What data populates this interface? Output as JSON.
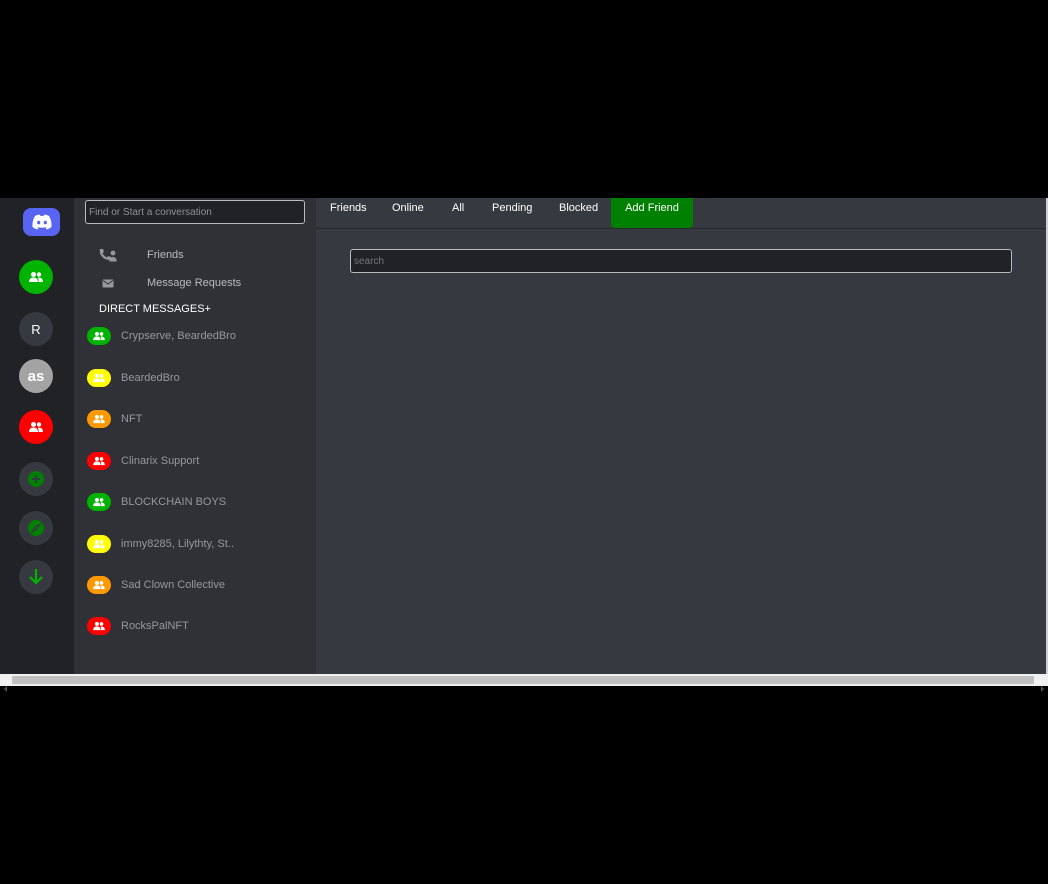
{
  "colors": {
    "discord": "#5865f2",
    "green": "#00b300",
    "yellow": "#ffff00",
    "orange": "#ff9900",
    "red": "#ff0000",
    "add_friend_bg": "#008000",
    "server_bg": "#36393f"
  },
  "servers": {
    "home_icon": "discord-logo-icon",
    "items": [
      {
        "icon": "group-icon",
        "color": "#00b300"
      },
      {
        "letter": "R"
      },
      {
        "letter": "as"
      },
      {
        "icon": "group-icon",
        "color": "#ff0000"
      },
      {
        "icon": "plus-icon"
      },
      {
        "icon": "compass-icon"
      },
      {
        "icon": "download-icon"
      }
    ]
  },
  "search": {
    "placeholder": "Find or Start a conversation"
  },
  "nav": {
    "friends": {
      "label": "Friends",
      "icon": "friends-phone-icon"
    },
    "message_requests": {
      "label": "Message Requests",
      "icon": "envelope-icon"
    }
  },
  "direct_messages": {
    "header": "DIRECT MESSAGES+",
    "items": [
      {
        "label": "Crypserve, BeardedBro",
        "color": "#00b300"
      },
      {
        "label": "BeardedBro",
        "color": "#ffff00"
      },
      {
        "label": "NFT",
        "color": "#ff9900"
      },
      {
        "label": "Clinarix Support",
        "color": "#ff0000"
      },
      {
        "label": "BLOCKCHAIN BOYS",
        "color": "#00b300"
      },
      {
        "label": "immy8285, Lilythty, St..",
        "color": "#ffff00"
      },
      {
        "label": "Sad Clown Collective",
        "color": "#ff9900"
      },
      {
        "label": "RocksPalNFT",
        "color": "#ff0000"
      }
    ]
  },
  "tabs": {
    "friends": "Friends",
    "online": "Online",
    "all": "All",
    "pending": "Pending",
    "blocked": "Blocked",
    "add_friend": "Add Friend"
  },
  "friend_search": {
    "placeholder": "search"
  }
}
